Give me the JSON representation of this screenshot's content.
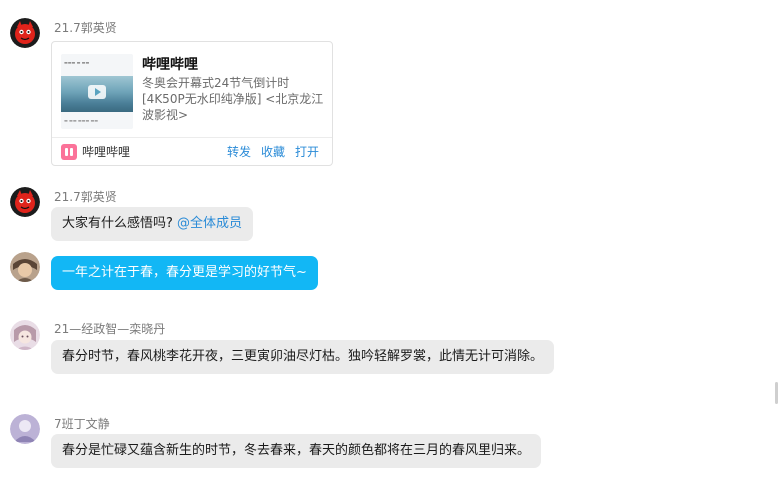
{
  "messages": [
    {
      "sender": "21.7郭英贤",
      "card": {
        "title": "哔哩哔哩",
        "description": "冬奥会开幕式24节气倒计时[4K50P无水印纯净版] <北京龙江波影视>",
        "source": "哔哩哔哩",
        "actions": [
          "转发",
          "收藏",
          "打开"
        ]
      }
    },
    {
      "sender": "21.7郭英贤",
      "text": "大家有什么感悟吗?",
      "mention": "@全体成员"
    },
    {
      "text": "一年之计在于春，春分更是学习的好节气~"
    },
    {
      "sender": "21—经政智—栾晓丹",
      "text": "春分时节，春风桃李花开夜，三更寅卯油尽灯枯。独吟轻解罗裳，此情无计可消除。"
    },
    {
      "sender": "7班丁文静",
      "text": "春分是忙碌又蕴含新生的时节，冬去春来，春天的颜色都将在三月的春风里归来。"
    }
  ],
  "colors": {
    "self_bubble": "#12b7f5",
    "other_bubble": "#ebebeb",
    "link": "#2a8bd7",
    "bilibili_pink": "#fb7299"
  },
  "icons": {
    "card_logo": "bilibili-icon",
    "thumb_play": "play-icon"
  }
}
